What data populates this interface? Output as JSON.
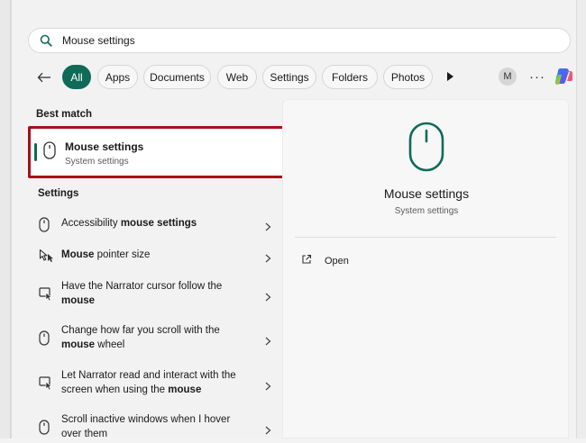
{
  "search": {
    "value": "Mouse settings"
  },
  "filters": {
    "chips": [
      "All",
      "Apps",
      "Documents",
      "Web",
      "Settings",
      "Folders",
      "Photos"
    ],
    "active_index": 0,
    "avatar_initial": "M",
    "more_label": "···"
  },
  "best_match": {
    "heading": "Best match",
    "title": "Mouse settings",
    "subtitle": "System settings"
  },
  "settings": {
    "heading": "Settings",
    "items": [
      {
        "icon": "mouse-icon",
        "parts": [
          [
            "Accessibility ",
            false
          ],
          [
            "mouse settings",
            true
          ]
        ]
      },
      {
        "icon": "mouse-pointer-icon",
        "parts": [
          [
            "Mouse",
            true
          ],
          [
            " pointer size",
            false
          ]
        ]
      },
      {
        "icon": "narrator-icon",
        "parts": [
          [
            "Have the Narrator cursor follow the ",
            false
          ],
          [
            "mouse",
            true
          ]
        ]
      },
      {
        "icon": "mouse-icon",
        "parts": [
          [
            "Change how far you scroll with the ",
            false
          ],
          [
            "mouse",
            true
          ],
          [
            " wheel",
            false
          ]
        ]
      },
      {
        "icon": "narrator-icon",
        "parts": [
          [
            "Let Narrator read and interact with the screen when using the ",
            false
          ],
          [
            "mouse",
            true
          ]
        ]
      },
      {
        "icon": "mouse-icon",
        "parts": [
          [
            "Scroll inactive windows when I hover over them",
            false
          ]
        ]
      }
    ]
  },
  "preview": {
    "title": "Mouse settings",
    "subtitle": "System settings",
    "open_label": "Open"
  },
  "colors": {
    "accent": "#0f6b58",
    "highlight": "#a80e1b"
  }
}
